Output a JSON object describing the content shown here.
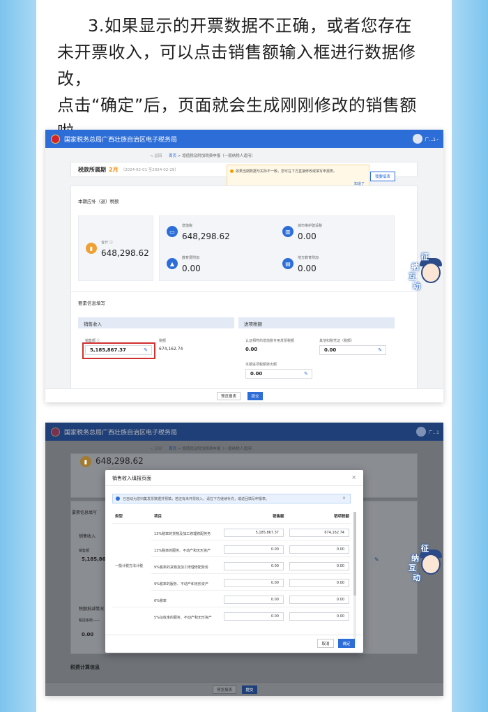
{
  "intro": {
    "line1": "3.如果显示的开票数据不正确，或者您存在",
    "line2": "未开票收入，可以点击销售额输入框进行数据修改，",
    "line3": "点击“确定”后，页面就会生成刚刚修改的销售额",
    "line4": "啦。"
  },
  "app": {
    "title": "国家税务总局广西壮族自治区电子税务局",
    "user": "广...1",
    "back": "< 返回",
    "breadcrumb_home": "首页",
    "breadcrumb_sep": ">",
    "breadcrumb_page": "增值税及附加税费申报（一般纳税人适用）"
  },
  "period": {
    "label": "税款所属期",
    "month": "2月",
    "range": "（2024-02-01 至2024-02-29）"
  },
  "tip": {
    "text": "如果当期数据与实际不一致，您可在下方直接修改或填写申报表。",
    "ok": "知道了",
    "button": "我要填表"
  },
  "tax_section": {
    "title": "本期应补（退）税额",
    "total_label": "合计 ⓘ",
    "total_value": "648,298.62",
    "vat_label": "增值税",
    "vat_value": "648,298.62",
    "city_label": "城市维护建设税",
    "city_value": "0.00",
    "edu_label": "教育费附加",
    "edu_value": "0.00",
    "local_edu_label": "地方教育附加",
    "local_edu_value": "0.00"
  },
  "info_section": {
    "title": "要素信息填写",
    "sales_header": "销售收入",
    "sales_label": "销售额 ⓘ",
    "sales_value": "5,185,867.37",
    "tax_label": "税额",
    "tax_value": "674,162.74",
    "input_header": "进项税额",
    "cert_label": "认证相符的增值税专用发票税额",
    "cert_value": "0.00",
    "other_label": "其他扣税凭证（税额）",
    "other_value": "0.00",
    "transfer_label": "本期进项税额转出额",
    "transfer_value": "0.00"
  },
  "footer": {
    "preview": "预览报表",
    "submit": "提交"
  },
  "modal": {
    "title": "销售收入填报页面",
    "close": "×",
    "banner": "已自动为您归集发票数据并预填，若还有未开票收入，请在下方继续补充，或返回填写申报表。",
    "col_type": "类型",
    "col_item": "项目",
    "col_sales": "销售额",
    "col_tax": "销项税额",
    "type_group": "一般计税方法计税",
    "rows": [
      {
        "item": "13%税率的货物及加工修理修配劳务",
        "sales": "5,185,867.37",
        "tax": "674,162.74"
      },
      {
        "item": "13%税率的服务、不动产和无形资产",
        "sales": "0.00",
        "tax": "0.00"
      },
      {
        "item": "9%税率的货物及加工修理修配劳务",
        "sales": "0.00",
        "tax": "0.00"
      },
      {
        "item": "9%税率的服务、不动产和无形资产",
        "sales": "0.00",
        "tax": "0.00"
      },
      {
        "item": "6%税率",
        "sales": "0.00",
        "tax": "0.00"
      },
      {
        "item": "5%征收率的服务、不动产和无形资产",
        "sales": "0.00",
        "tax": "0.00"
      }
    ],
    "cancel": "取消",
    "confirm": "确定"
  },
  "bg2": {
    "total_value": "648,298.62",
    "info_title": "要素信息填写",
    "sales_header": "销售收入",
    "sales_label": "销售额",
    "sales_value": "5,185,86",
    "section2": "税费计算信息",
    "value3": "0.00",
    "header3": "税额抵减情况",
    "label3": "税控系统——"
  },
  "mascot": {
    "c1": "征",
    "c2": "纳",
    "c3": "互",
    "c4": "动"
  },
  "colors": {
    "brand": "#2d6dd7",
    "highlight": "#d32f2f",
    "warn": "#f08c00"
  }
}
